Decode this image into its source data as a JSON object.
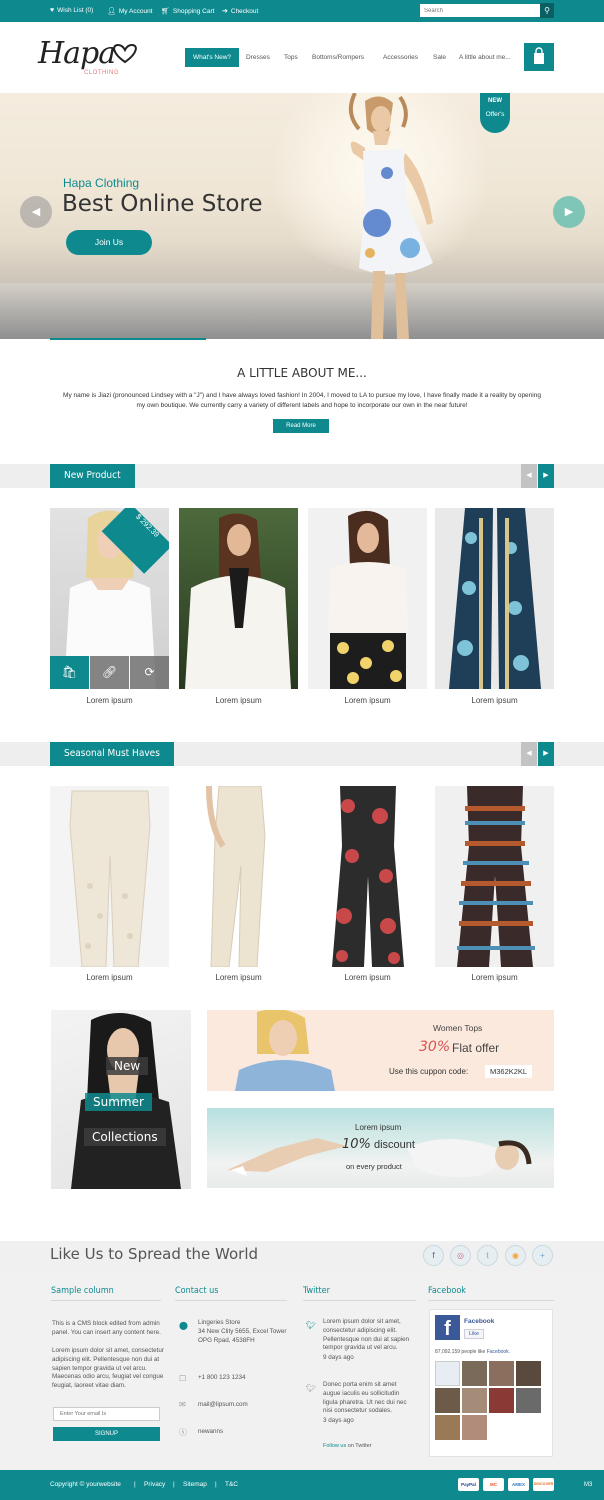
{
  "topbar": {
    "wishlist": "Wish List (0)",
    "account": "My Account",
    "cart": "Shopping Cart",
    "checkout": "Checkout",
    "search_placeholder": "Search"
  },
  "header": {
    "logo": "Hapa",
    "logo_sub": "CLOTHING",
    "nav": [
      "What's New?",
      "Dresses",
      "Tops",
      "Bottoms/Rompers",
      "Accessories",
      "Sale",
      "A little about me..."
    ]
  },
  "hero": {
    "subtitle": "Hapa Clothing",
    "title": "Best Online Store",
    "button": "Join Us",
    "badge_top": "NEW",
    "badge_bottom": "Offer's"
  },
  "about": {
    "title": "A LITTLE ABOUT ME...",
    "text": "My name is Jiazi (pronounced Lindsey with a \"J\") and I have always loved fashion! In 2004, I moved to LA to pursue my love, I have finally made it a reality by opening my own boutique. We currently carry a variety of different labels and hope to incorporate our own in the near future!",
    "button": "Read More"
  },
  "new_products": {
    "title": "New Product",
    "price_badge": "$ 292.39",
    "items": [
      {
        "label": "Lorem ipsum"
      },
      {
        "label": "Lorem ipsum"
      },
      {
        "label": "Lorem ipsum"
      },
      {
        "label": "Lorem ipsum"
      }
    ]
  },
  "seasonal": {
    "title": "Seasonal Must Haves",
    "items": [
      {
        "label": "Lorem ipsum"
      },
      {
        "label": "Lorem ipsum"
      },
      {
        "label": "Lorem ipsum"
      },
      {
        "label": "Lorem ipsum"
      }
    ]
  },
  "promos": {
    "left": [
      "New",
      "Summer",
      "Collections"
    ],
    "top_right": {
      "heading": "Women Tops",
      "percent": "30%",
      "offer": "Flat offer",
      "coupon_label": "Use this cuppon code:",
      "coupon": "M362K2KL"
    },
    "bottom_right": {
      "line1": "Lorem ipsum",
      "percent": "10%",
      "discount": "discount",
      "line3": "on every product"
    }
  },
  "social": {
    "title": "Like Us to Spread the World",
    "icons": [
      "f",
      "◎",
      "t",
      "◉",
      "+"
    ]
  },
  "footer": {
    "col1": {
      "title": "Sample column",
      "p1": "This is a CMS block edited from admin panel. You can insert any content here.",
      "p2": "Lorem ipsum dolor sit amet, consectetur adipiscing elit. Pellentesque non dui at sapien tempor gravida ut vel arcu. Maecenas odio arcu, feugiat vel congue feugiat, laoreet vitae diam.",
      "email_placeholder": "Enter Your email Is",
      "signup": "SIGNUP"
    },
    "col2": {
      "title": "Contact us",
      "address": [
        "Lingeries Store",
        "34 New Clity 5655, Excel Tower",
        "OPG Rpad, 4538FH"
      ],
      "phone": "+1 800 123 1234",
      "email": "mail@lipsum.com",
      "skype": "newanns"
    },
    "col3": {
      "title": "Twitter",
      "tweet1": "Lorem ipsum dolor sit amet, consectetur adipiscing elit. Pellentesque non dui at sapien tempor gravida ut vel arcu.",
      "time1": "9 days ago",
      "tweet2": "Donec porta enim sit amet augue iaculis eu sollicitudin ligula pharetra. Ut nec dui nec nisi consectetur sodales.",
      "time2": "3 days ago",
      "follow_prefix": "Follow us",
      "follow_suffix": "on Twitter"
    },
    "col4": {
      "title": "Facebook",
      "page_name": "Facebook",
      "like_button": "Like",
      "likes_text": "87,092,159 people like",
      "likes_link": "Facebook."
    }
  },
  "bottombar": {
    "copyright": "Copyright © yourwebsite",
    "links": [
      "Privacy",
      "Sitemap",
      "T&C"
    ],
    "payments": [
      "PayPal",
      "MC",
      "AMEX",
      "DISCOVER"
    ],
    "version": "M3"
  },
  "colors": {
    "accent": "#0e8a8f",
    "accent_dark": "#0a5f63",
    "promo_peach": "#fbe9de",
    "offer_red": "#d9534f"
  }
}
